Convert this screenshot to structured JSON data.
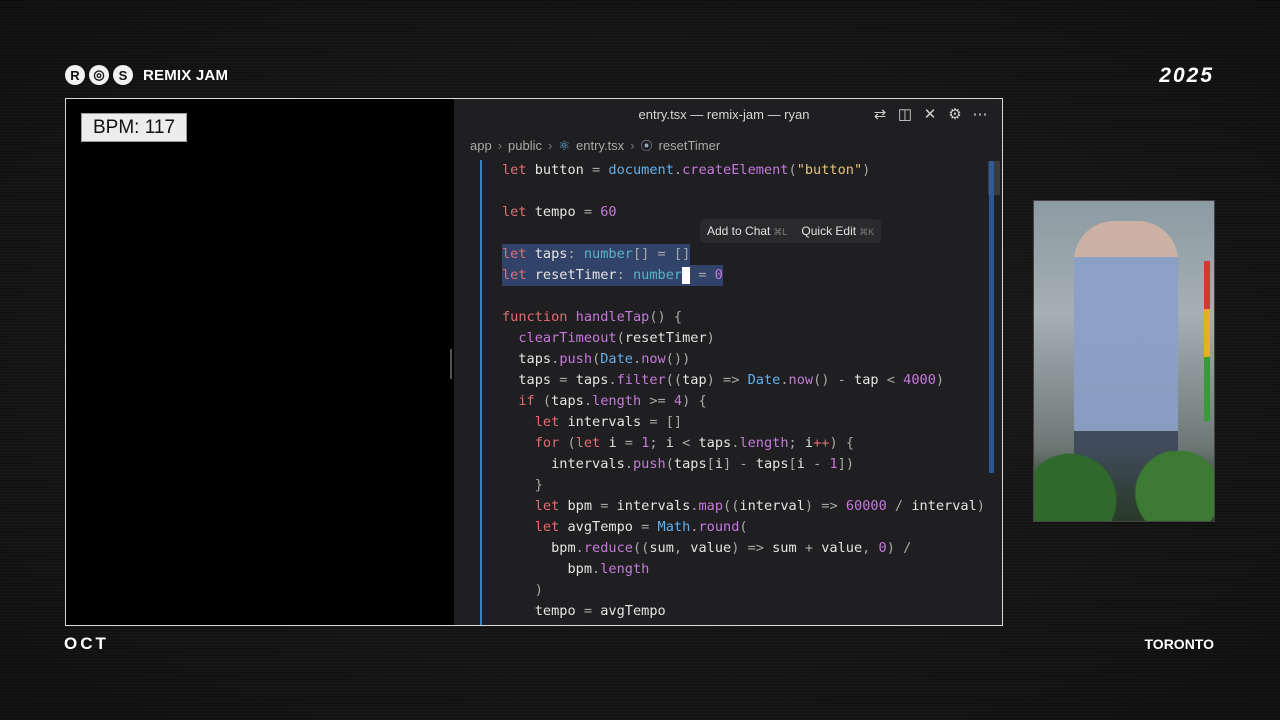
{
  "event": {
    "brand_badges": [
      "R",
      "◎",
      "S"
    ],
    "name": "REMIX JAM",
    "year": "2025",
    "month": "OCT",
    "city": "TORONTO"
  },
  "app": {
    "bpm_label": "BPM: 117"
  },
  "editor": {
    "window_title": "entry.tsx — remix-jam — ryan",
    "toolbar_icons": [
      "git-compare-icon",
      "split-editor-icon",
      "close-icon",
      "gear-icon",
      "more-icon"
    ],
    "breadcrumb": {
      "items": [
        "app",
        "public",
        "entry.tsx",
        "resetTimer"
      ]
    },
    "hover_toolbar": {
      "add_to_chat": "Add to Chat",
      "add_to_chat_kbd": "⌘L",
      "quick_edit": "Quick Edit",
      "quick_edit_kbd": "⌘K"
    },
    "code_lines": [
      "let button = document.createElement(\"button\")",
      "",
      "let tempo = 60",
      "",
      "let taps: number[] = []",
      "let resetTimer: number = 0",
      "",
      "function handleTap() {",
      "  clearTimeout(resetTimer)",
      "  taps.push(Date.now())",
      "  taps = taps.filter((tap) => Date.now() - tap < 4000)",
      "  if (taps.length >= 4) {",
      "    let intervals = []",
      "    for (let i = 1; i < taps.length; i++) {",
      "      intervals.push(taps[i] - taps[i - 1])",
      "    }",
      "    let bpm = intervals.map((interval) => 60000 / interval)",
      "    let avgTempo = Math.round(",
      "      bpm.reduce((sum, value) => sum + value, 0) /",
      "        bpm.length",
      "    )",
      "    tempo = avgTempo"
    ]
  }
}
